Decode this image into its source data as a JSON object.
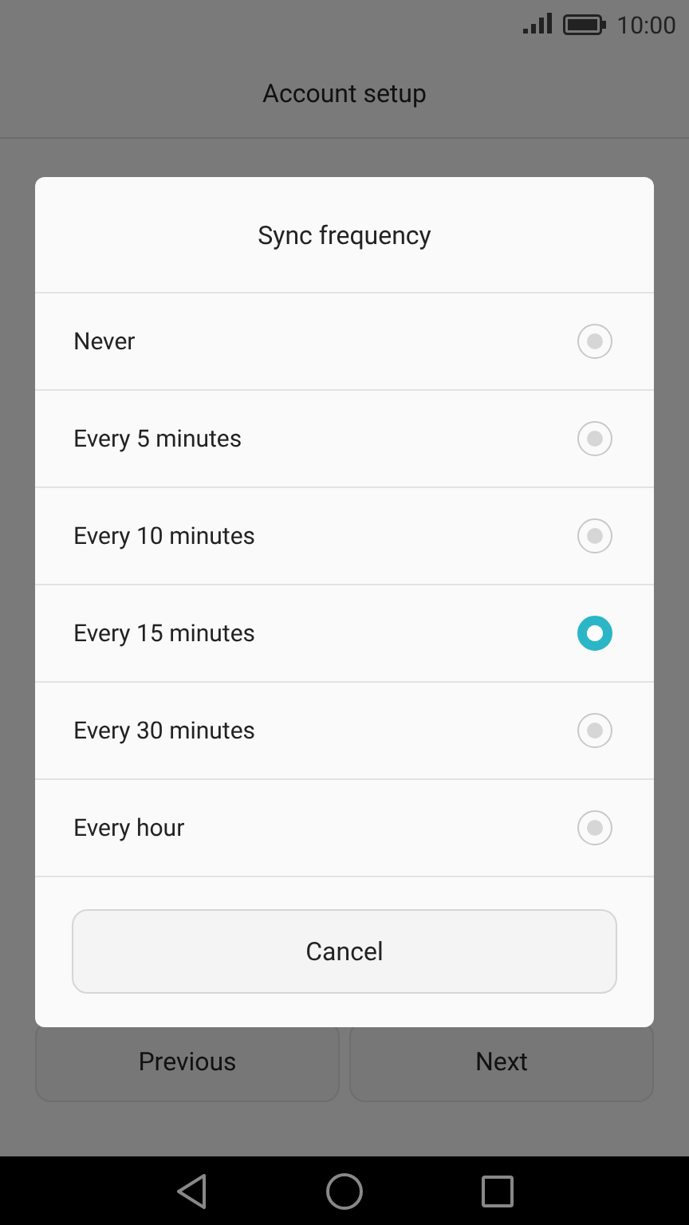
{
  "status_bar": {
    "time": "10:00"
  },
  "header": {
    "title": "Account setup"
  },
  "buttons": [
    {
      "label": "Previous"
    },
    {
      "label": "Next"
    }
  ],
  "dialog": {
    "title": "Sync frequency",
    "options": [
      {
        "label": "Never",
        "selected": false
      },
      {
        "label": "Every 5 minutes",
        "selected": false
      },
      {
        "label": "Every 10 minutes",
        "selected": false
      },
      {
        "label": "Every 15 minutes",
        "selected": true
      },
      {
        "label": "Every 30 minutes",
        "selected": false
      },
      {
        "label": "Every hour",
        "selected": false
      }
    ],
    "cancel": "Cancel"
  }
}
